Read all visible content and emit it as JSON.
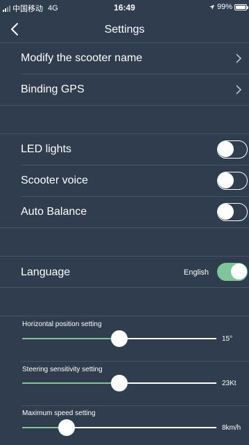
{
  "status": {
    "carrier": "中国移动",
    "network": "4G",
    "time": "16:49",
    "battery": "99%"
  },
  "nav": {
    "title": "Settings"
  },
  "menu": {
    "rename": "Modify the scooter name",
    "gps": "Binding GPS"
  },
  "toggles": [
    {
      "label": "LED lights",
      "on": false
    },
    {
      "label": "Scooter voice",
      "on": false
    },
    {
      "label": "Auto Balance",
      "on": false
    }
  ],
  "language": {
    "label": "Language",
    "value": "English",
    "on": true
  },
  "sliders": [
    {
      "label": "Horizontal position setting",
      "value": "15°",
      "level": 0.5
    },
    {
      "label": "Steering sensitivity setting",
      "value": "23Kt",
      "level": 0.5
    },
    {
      "label": "Maximum speed setting",
      "value": "8km/h",
      "level": 0.23
    }
  ],
  "colors": {
    "background": "#2f3d4e",
    "accent": "#7fc49b",
    "divider": "#46566a"
  }
}
